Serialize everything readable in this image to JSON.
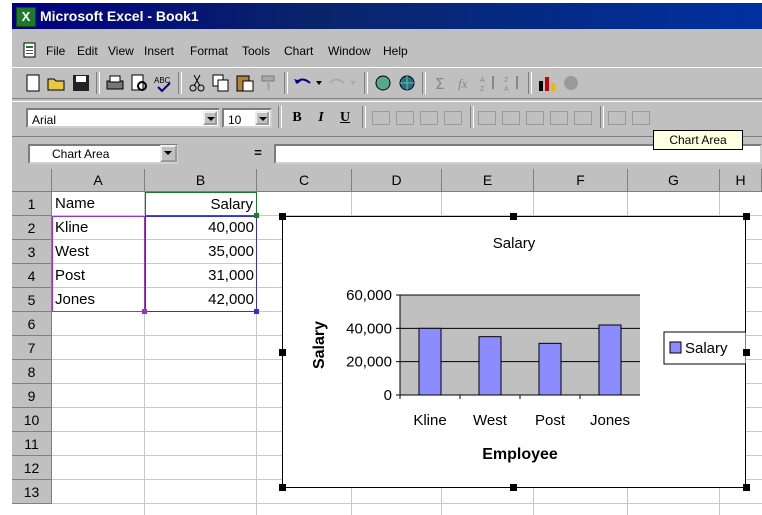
{
  "app": {
    "title": "Microsoft Excel - Book1"
  },
  "menu": [
    "File",
    "Edit",
    "View",
    "Insert",
    "Format",
    "Tools",
    "Chart",
    "Window",
    "Help"
  ],
  "formatting": {
    "font": "Arial",
    "size": "10",
    "bold": "B",
    "italic": "I",
    "underline": "U"
  },
  "formula_bar": {
    "name_box": "Chart Area",
    "equals": "="
  },
  "sheet": {
    "columns": [
      "A",
      "B",
      "C",
      "D",
      "E",
      "F",
      "G",
      "H"
    ],
    "rows": [
      "1",
      "2",
      "3",
      "4",
      "5",
      "6",
      "7",
      "8",
      "9",
      "10",
      "11",
      "12",
      "13"
    ],
    "cells": [
      {
        "a": "Name",
        "b": "Salary"
      },
      {
        "a": "Kline",
        "b": "40,000"
      },
      {
        "a": "West",
        "b": "35,000"
      },
      {
        "a": "Post",
        "b": "31,000"
      },
      {
        "a": "Jones",
        "b": "42,000"
      }
    ]
  },
  "tooltip": "Chart Area",
  "colors": {
    "bar": "#8c8cff",
    "plot_bg": "#c0c0c0",
    "selection": "#9933cc",
    "title_bar": "#000080"
  },
  "chart_data": {
    "type": "bar",
    "title": "Salary",
    "xlabel": "Employee",
    "ylabel": "Salary",
    "categories": [
      "Kline",
      "West",
      "Post",
      "Jones"
    ],
    "series": [
      {
        "name": "Salary",
        "values": [
          40000,
          35000,
          31000,
          42000
        ]
      }
    ],
    "ylim": [
      0,
      60000
    ],
    "yticks": [
      0,
      20000,
      40000,
      60000
    ],
    "ytick_labels": [
      "0",
      "20,000",
      "40,000",
      "60,000"
    ],
    "grid": true,
    "legend": "right"
  }
}
